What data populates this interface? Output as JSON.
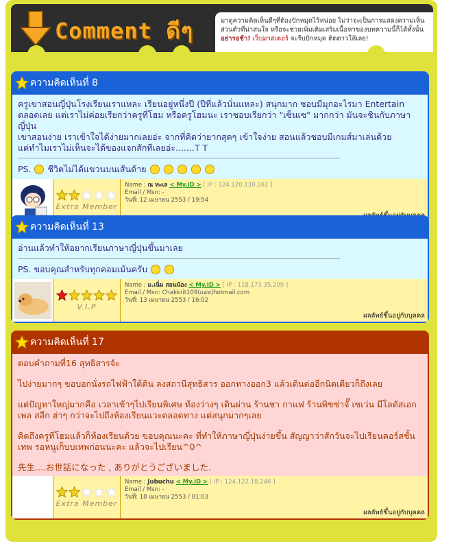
{
  "header": {
    "banner_title": "Comment ดีๆ",
    "notice_text_1": "มาดูความคิดเห็นดีๆที่ต้องปักหมุดไว้หน่อย ไม่ว่าจะเป็นการแสดงความเห็นส่วนตัวที่น่าสนใจ หรือจะช่วยเพิ่มเติมเสริมเนื้อหาของบทความนี้ก็ได้ทั้งนั้น",
    "notice_strong": "อย่ารอช้า!",
    "notice_link": "เว็บมาสเตอร์",
    "notice_text_2": "จะรีบปักหมุด ติดดาวให้เลย!"
  },
  "comments": [
    {
      "title": "ความคิดเห็นที่ 8",
      "body": [
        "ครูเขาสอนญี่ปุ่นโรงเรียนเราแหละ  เรียนอยู่หนึ่งปี (ปีที่แล้วนั่นแหละ) สนุกมาก  ชอบมีมุกอะไรมา Entertain ตลอดเลย แต่เราไม่ค่อยเรียกว่าครูที่โฮม หรือครูโฮมนะ  เราชอบเรียกว่า \"เซ็นเซ\" มากกว่า มันจะชินกับภาษาญี่ปุ่น",
        "เขาสอนง่าย  เราเข้าใจได้ง่ายมากเลยอ่ะ  จากที่คิดว่ายากสุดๆ เข้าใจง่าย  สอนแล้วชอบมีเกมส์มาเล่นด้วย",
        "แต่ทำไมเราไม่เห็นจะได้ของแจกสักทีเลยอ่ะ.......T T"
      ],
      "ps_label": "PS.",
      "ps_text": "ชีวิตไม่ได้แขวนบนเส้นด้าย",
      "name": "ณ ทะเล",
      "myid": "< My.iD >",
      "ip": "[ IP : 124.120.130.162 ]",
      "email": "Email / Msn: -",
      "date": "วันที่: 12 เมษายน 2553 / 19:54",
      "rank_label": "Extra Member",
      "result": "ผลลัพธ์ขึ้นอยู่กับบุคคล"
    },
    {
      "title": "ความคิดเห็นที่ 13",
      "body": [
        "อ่านแล้วทำให้อยากเรียนภาษาญี่ปุ่นขึ้นมาเลย"
      ],
      "ps_label": "PS.",
      "ps_text": "ขอบคุณสำหรับทุกคอมเม้นครับ",
      "name": "ม.เนิ่ม สอนน้อง",
      "myid": "< My.iD >",
      "ip": "[ IP : 118.173.35.209 ]",
      "email": "Email / Msn: Chakkrit109(แอท)hotmail.com",
      "date": "วันที่: 13 เมษายน 2553 / 16:02",
      "rank_label": "V.I.P",
      "result": "ผลลัพธ์ขึ้นอยู่กับบุคคล"
    },
    {
      "title": "ความคิดเห็นที่ 17",
      "body": [
        "ตอบคำถามที่16  สุทธิสารจ้ะ",
        "ไปง่ายมากๆ ขอบอกนั่งรถไฟฟ้าใต้ดิน ลงสถานีสุทธิสาร ออกทางออก3 แล้วเดินต่ออีกนิดเดียวก็ถึงเลย",
        "แต่ปัญหาใหญ่มากคือ เวลาเข้าๆไปเรียนพิเศษ ท้องว่างๆ เดินผ่าน ร้านชา กาแฟ ร้านพิซซ่าจั๊ เซเว่น มีโลตัสเอกเพล สอีก ฮ่าๆ กว่าจะไปถึงห้องเรียนแวะตลอดทาง แต่สนุกมากๆเลย",
        "คิดถึงครูที่โฮมแล้วก็ห้องเรียนด้วย ขอบคุณนะคะ ที่ทำให้ภาษาญี่ปุ่นง่ายขึ้น สัญญาว่าสักวันจะไปเรียนคอร์สชั้นเทพ รอหนูเก็บบเทพก่อนนะคะ แล้วจะไปเรียน^0^",
        "先生....お世話になった , ありがとうございました."
      ],
      "name": "Jubuchu",
      "myid": "< My.iD >",
      "ip": "[ IP : 124.122.18.246 ]",
      "email": "Email / Msn: -",
      "date": "วันที่: 18 เมษายน 2553 / 01:03",
      "rank_label": "Extra Member",
      "result": "ผลลัพธ์ขึ้นอยู่กับบุคคล"
    }
  ],
  "colors": {
    "blue_card": "#1a62d8",
    "red_card": "#b03400",
    "frame": "#dfe23a"
  }
}
